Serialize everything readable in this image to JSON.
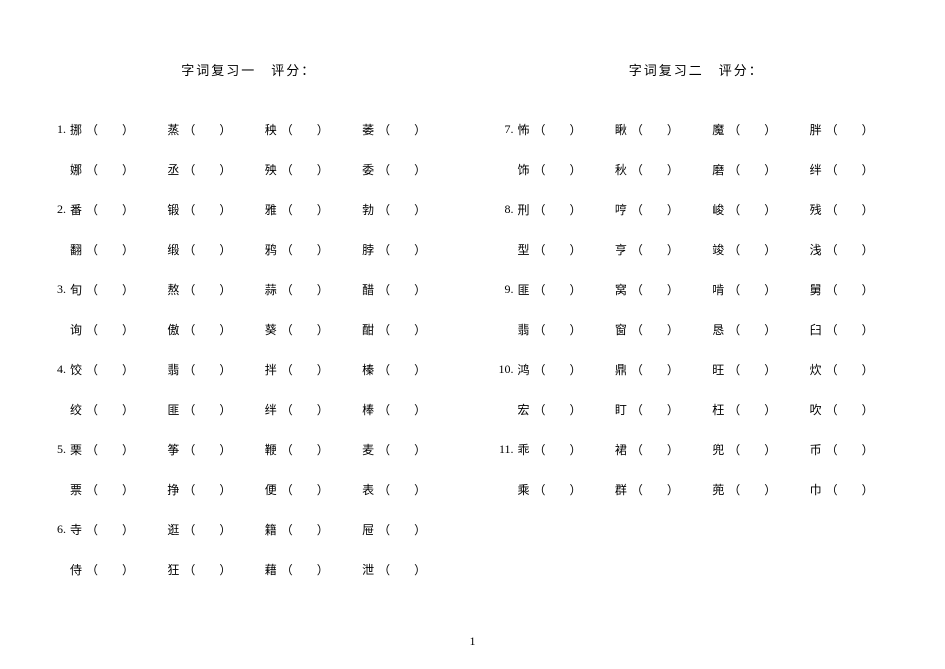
{
  "footer": "1",
  "left": {
    "title": "字词复习一　评分：",
    "rows": [
      {
        "num": "1.",
        "cells": [
          "挪",
          "蒸",
          "秧",
          "萎"
        ]
      },
      {
        "num": "",
        "cells": [
          "娜",
          "丞",
          "殃",
          "委"
        ]
      },
      {
        "num": "2.",
        "cells": [
          "番",
          "锻",
          "雅",
          "勃"
        ]
      },
      {
        "num": "",
        "cells": [
          "翻",
          "缎",
          "鸦",
          "脖"
        ]
      },
      {
        "num": "3.",
        "cells": [
          "旬",
          "熬",
          "蒜",
          "醋"
        ]
      },
      {
        "num": "",
        "cells": [
          "询",
          "傲",
          "葵",
          "酣"
        ]
      },
      {
        "num": "4.",
        "cells": [
          "饺",
          "翡",
          "拌",
          "榛"
        ]
      },
      {
        "num": "",
        "cells": [
          "绞",
          "匪",
          "绊",
          "棒"
        ]
      },
      {
        "num": "5.",
        "cells": [
          "栗",
          "筝",
          "鞭",
          "麦"
        ]
      },
      {
        "num": "",
        "cells": [
          "票",
          "挣",
          "便",
          "表"
        ]
      },
      {
        "num": "6.",
        "cells": [
          "寺",
          "逛",
          "籍",
          "屉"
        ]
      },
      {
        "num": "",
        "cells": [
          "侍",
          "狂",
          "藉",
          "泄"
        ]
      }
    ]
  },
  "right": {
    "title": "字词复习二　评分：",
    "rows": [
      {
        "num": "7.",
        "cells": [
          "怖",
          "瞅",
          "魔",
          "胖"
        ]
      },
      {
        "num": "",
        "cells": [
          "饰",
          "秋",
          "磨",
          "绊"
        ]
      },
      {
        "num": "8.",
        "cells": [
          "刑",
          "哼",
          "峻",
          "残"
        ]
      },
      {
        "num": "",
        "cells": [
          "型",
          "亨",
          "竣",
          "浅"
        ]
      },
      {
        "num": "9.",
        "cells": [
          "匪",
          "窝",
          "啃",
          "舅"
        ]
      },
      {
        "num": "",
        "cells": [
          "翡",
          "窗",
          "恳",
          "臼"
        ]
      },
      {
        "num": "10.",
        "cells": [
          "鸿",
          "鼎",
          "旺",
          "炊"
        ]
      },
      {
        "num": "",
        "cells": [
          "宏",
          "盯",
          "枉",
          "吹"
        ]
      },
      {
        "num": "11.",
        "cells": [
          "乖",
          "裙",
          "兜",
          "币"
        ]
      },
      {
        "num": "",
        "cells": [
          "乘",
          "群",
          "蔸",
          "巾"
        ]
      }
    ]
  }
}
